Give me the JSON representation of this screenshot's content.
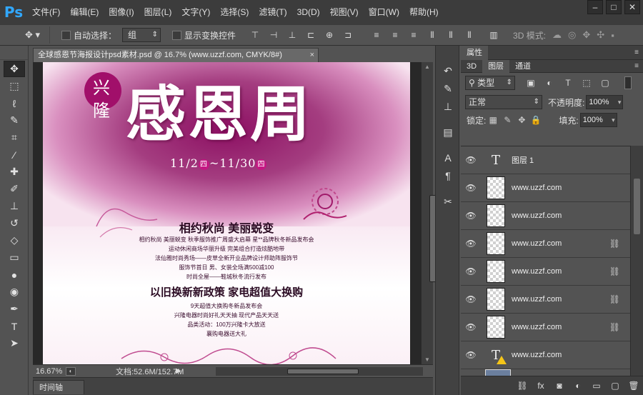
{
  "app": {
    "logo": "Ps",
    "menu": [
      "文件(F)",
      "编辑(E)",
      "图像(I)",
      "图层(L)",
      "文字(Y)",
      "选择(S)",
      "滤镜(T)",
      "3D(D)",
      "视图(V)",
      "窗口(W)",
      "帮助(H)"
    ],
    "window_controls": [
      "minimize",
      "maximize",
      "close"
    ]
  },
  "options_bar": {
    "tool_icon": "move-tool-icon",
    "auto_select_label": "自动选择：",
    "auto_select_value": "组",
    "show_transform_label": "显示变换控件",
    "mode3d_label": "3D 模式:"
  },
  "tools": [
    "move",
    "marquee",
    "lasso",
    "quick-select",
    "crop",
    "eyedropper",
    "healing",
    "brush",
    "stamp",
    "history-brush",
    "eraser",
    "gradient",
    "blur",
    "dodge",
    "pen",
    "type",
    "path-select"
  ],
  "document": {
    "tab_title": "全球感恩节海报设计psd素材.psd @ 16.7% (www.uzzf.com, CMYK/8#)",
    "close": "×",
    "zoom": "16.67%",
    "doc_size": "文档:52.6M/152.7M"
  },
  "poster": {
    "bubble_top": "兴",
    "bubble_bottom": "隆",
    "headline": "感恩周",
    "dates_start": "11/2",
    "weekday1": "四",
    "dates_sep": "~11/30",
    "weekday2": "四",
    "heading1": "相约秋尚 美丽蜕变",
    "lines1": [
      "相约秋尚 美丽蜕变 秋季服饰推广周盛大启幕 星**品牌秋冬新品发布会",
      "运动休闲商场华丽升级 完美组合打造炫酷地带",
      "法仙雅时尚秀场——皮草全新开业品牌设计师助阵服饰节",
      "服饰节首日 男、女装全场满500减100",
      "时尚全屋——鞋城秋冬流行发布"
    ],
    "heading2": "以旧换新新政策 家电超值大换购",
    "lines2": [
      "9天超值大换购冬新品发布会",
      "兴隆电器时尚好礼天天抽 现代产品天天送",
      "品类活动：100万兴隆卡大放送",
      "襄购电器送大礼"
    ]
  },
  "timeline": {
    "tab": "时间轴"
  },
  "dock_icons": [
    "history-icon",
    "brush-presets-icon",
    "clone-source-icon",
    "tool-presets-icon",
    "character-icon",
    "paragraph-icon",
    "tools-icon"
  ],
  "properties_panel": {
    "tab": "属性",
    "menu": "≡"
  },
  "layers_panel": {
    "tabs": [
      "3D",
      "图层",
      "通道"
    ],
    "active_tab": "图层",
    "filter_kind": "类型",
    "blend_mode": "正常",
    "opacity_label": "不透明度:",
    "opacity_value": "100%",
    "lock_label": "锁定:",
    "fill_label": "填充:",
    "fill_value": "100%",
    "layers": [
      {
        "name": "图层 1",
        "type": "text",
        "linked": false
      },
      {
        "name": "www.uzzf.com",
        "type": "raster",
        "linked": false
      },
      {
        "name": "www.uzzf.com",
        "type": "raster",
        "linked": false
      },
      {
        "name": "www.uzzf.com",
        "type": "raster",
        "linked": true
      },
      {
        "name": "www.uzzf.com",
        "type": "raster",
        "linked": true
      },
      {
        "name": "www.uzzf.com",
        "type": "raster",
        "linked": true
      },
      {
        "name": "www.uzzf.com",
        "type": "raster",
        "linked": true
      },
      {
        "name": "www.uzzf.com",
        "type": "text-warning",
        "linked": false
      }
    ],
    "footer_icons": [
      "link-layers-icon",
      "fx-icon",
      "mask-icon",
      "adjustment-icon",
      "group-icon",
      "new-layer-icon",
      "trash-icon"
    ]
  },
  "colors": {
    "accent_ps": "#31a8ff",
    "poster_magenta": "#a10f6a",
    "warning": "#f5c518"
  }
}
